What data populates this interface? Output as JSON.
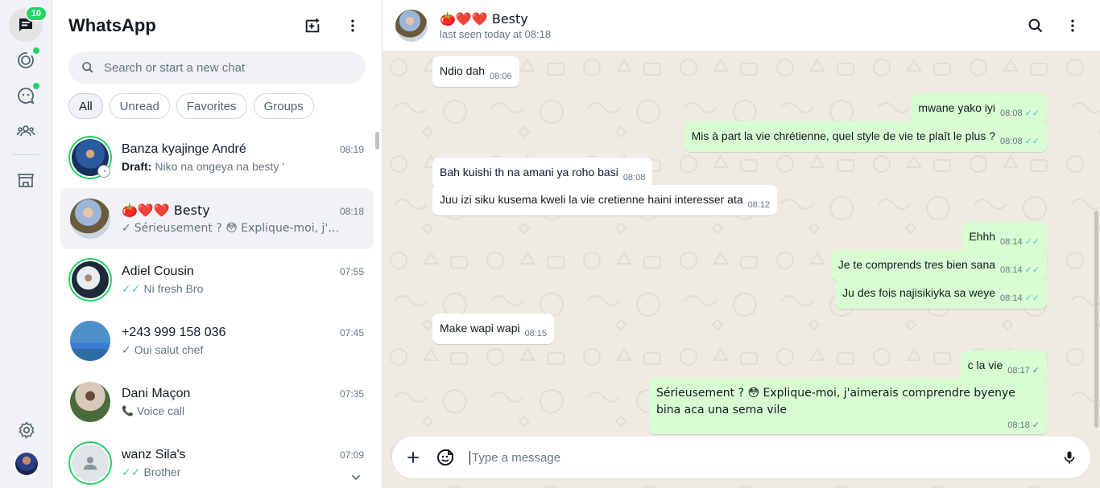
{
  "rail": {
    "chats_badge": "10",
    "items": [
      "chats-icon",
      "status-icon",
      "channels-icon",
      "communities-icon",
      "store-icon"
    ],
    "bottom": [
      "settings-icon",
      "profile-avatar"
    ]
  },
  "list": {
    "title": "WhatsApp",
    "search_placeholder": "Search or start a new chat",
    "filters": [
      "All",
      "Unread",
      "Favorites",
      "Groups"
    ],
    "chats": [
      {
        "name": "Banza kyajinge André",
        "time": "08:19",
        "prefix": "Draft:",
        "preview": "Niko na ongeya na besty '",
        "tick": ""
      },
      {
        "name": "🍅❤️❤️ Besty",
        "time": "08:18",
        "prefix": "",
        "preview": "Sérieusement ? 😳 Explique-moi, j'aime…",
        "tick": "✓"
      },
      {
        "name": "Adiel Cousin",
        "time": "07:55",
        "prefix": "",
        "preview": "Ni fresh Bro",
        "tick": "✓✓"
      },
      {
        "name": "+243 999 158 036",
        "time": "07:45",
        "prefix": "",
        "preview": "Oui salut chef",
        "tick": "✓"
      },
      {
        "name": "Dani Maçon",
        "time": "07:35",
        "prefix": "",
        "preview": "Voice call",
        "tick": "📞"
      },
      {
        "name": "wanz Sila's",
        "time": "07:09",
        "prefix": "",
        "preview": "Brother",
        "tick": "✓✓"
      }
    ]
  },
  "conversation": {
    "name": "🍅❤️❤️ Besty",
    "status": "last seen today at 08:18",
    "composer_placeholder": "Type a message",
    "messages": [
      {
        "dir": "in",
        "text": "Ndio dah",
        "time": "08:06"
      },
      {
        "dir": "out",
        "text": "mwane yako iyi",
        "time": "08:08",
        "tick": "✓✓"
      },
      {
        "dir": "out",
        "text": "Mis à part la vie chrétienne, quel style de vie te plaît le plus ?",
        "time": "08:08",
        "tick": "✓✓"
      },
      {
        "dir": "in",
        "text": "Bah kuishi th na amani ya roho basi",
        "time": "08:08"
      },
      {
        "dir": "in",
        "text": "Juu izi siku kusema kweli la vie cretienne haini interesser ata",
        "time": "08:12"
      },
      {
        "dir": "out",
        "text": "Ehhh",
        "time": "08:14",
        "tick": "✓✓"
      },
      {
        "dir": "out",
        "text": "Je te comprends tres bien sana",
        "time": "08:14",
        "tick": "✓✓"
      },
      {
        "dir": "out",
        "text": "Ju des fois najisikiyka sa weye",
        "time": "08:14",
        "tick": "✓✓"
      },
      {
        "dir": "in",
        "text": "Make wapi wapi",
        "time": "08:15"
      },
      {
        "dir": "out",
        "text": "c la vie",
        "time": "08:17",
        "tick": "✓"
      },
      {
        "dir": "out",
        "text": "Sérieusement ? 😳 Explique-moi, j'aimerais comprendre byenye bina aca una sema vile",
        "time": "08:18",
        "tick": "✓"
      }
    ]
  }
}
